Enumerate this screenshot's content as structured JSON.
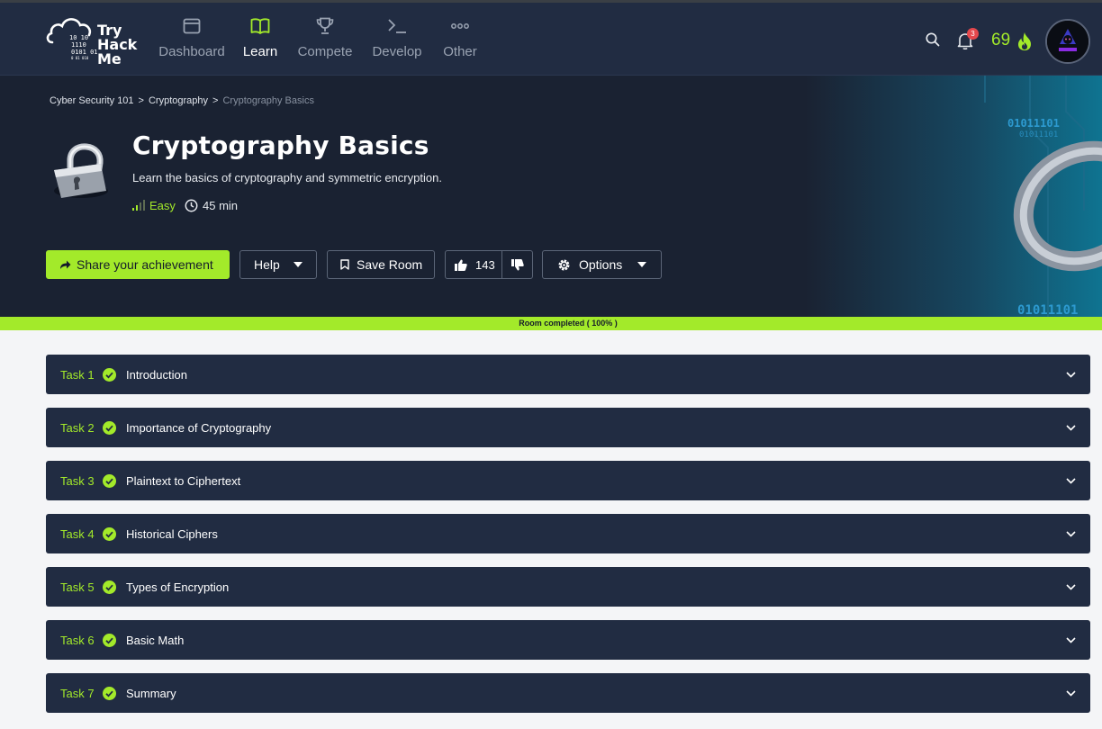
{
  "navbar": {
    "logo_lines": [
      "Try",
      "Hack",
      "Me"
    ],
    "items": [
      {
        "label": "Dashboard",
        "icon": "window-icon"
      },
      {
        "label": "Learn",
        "icon": "book-icon",
        "active": true
      },
      {
        "label": "Compete",
        "icon": "trophy-icon"
      },
      {
        "label": "Develop",
        "icon": "terminal-icon"
      },
      {
        "label": "Other",
        "icon": "more-dots-icon"
      }
    ],
    "notifications_count": "3",
    "streak": "69",
    "accent_color": "#a3ea2a"
  },
  "breadcrumb": [
    "Cyber Security 101",
    "Cryptography",
    "Cryptography Basics"
  ],
  "breadcrumb_sep": ">",
  "room": {
    "title": "Cryptography Basics",
    "description": "Learn the basics of cryptography and symmetric encryption.",
    "difficulty": "Easy",
    "duration": "45 min",
    "banner_text": [
      "01011101",
      "01011101",
      "01011101"
    ]
  },
  "actions": {
    "share": "Share your achievement",
    "help": "Help",
    "save": "Save Room",
    "upvotes": "143",
    "options": "Options"
  },
  "progress": {
    "text": "Room completed ( 100% )",
    "percent": 100
  },
  "tasks": [
    {
      "label": "Task 1",
      "title": "Introduction",
      "completed": true
    },
    {
      "label": "Task 2",
      "title": "Importance of Cryptography",
      "completed": true
    },
    {
      "label": "Task 3",
      "title": "Plaintext to Ciphertext",
      "completed": true
    },
    {
      "label": "Task 4",
      "title": "Historical Ciphers",
      "completed": true
    },
    {
      "label": "Task 5",
      "title": "Types of Encryption",
      "completed": true
    },
    {
      "label": "Task 6",
      "title": "Basic Math",
      "completed": true
    },
    {
      "label": "Task 7",
      "title": "Summary",
      "completed": true
    }
  ]
}
